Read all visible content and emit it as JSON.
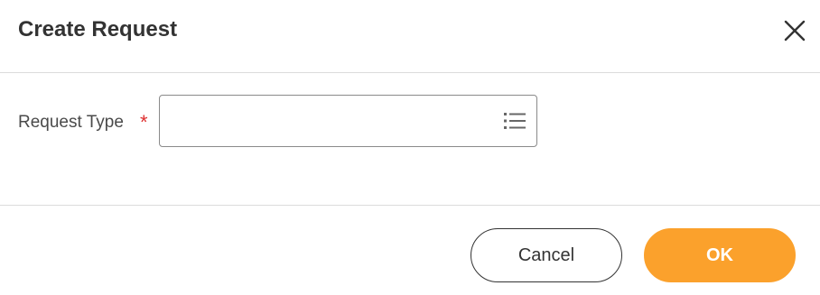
{
  "dialog": {
    "title": "Create Request",
    "close_icon": "close-icon"
  },
  "form": {
    "request_type": {
      "label": "Request Type",
      "required_marker": "*",
      "value": "",
      "prompt_icon": "list-icon"
    }
  },
  "actions": {
    "cancel_label": "Cancel",
    "ok_label": "OK"
  },
  "colors": {
    "primary": "#fba12c",
    "required": "#de2f2f",
    "text": "#333333"
  }
}
